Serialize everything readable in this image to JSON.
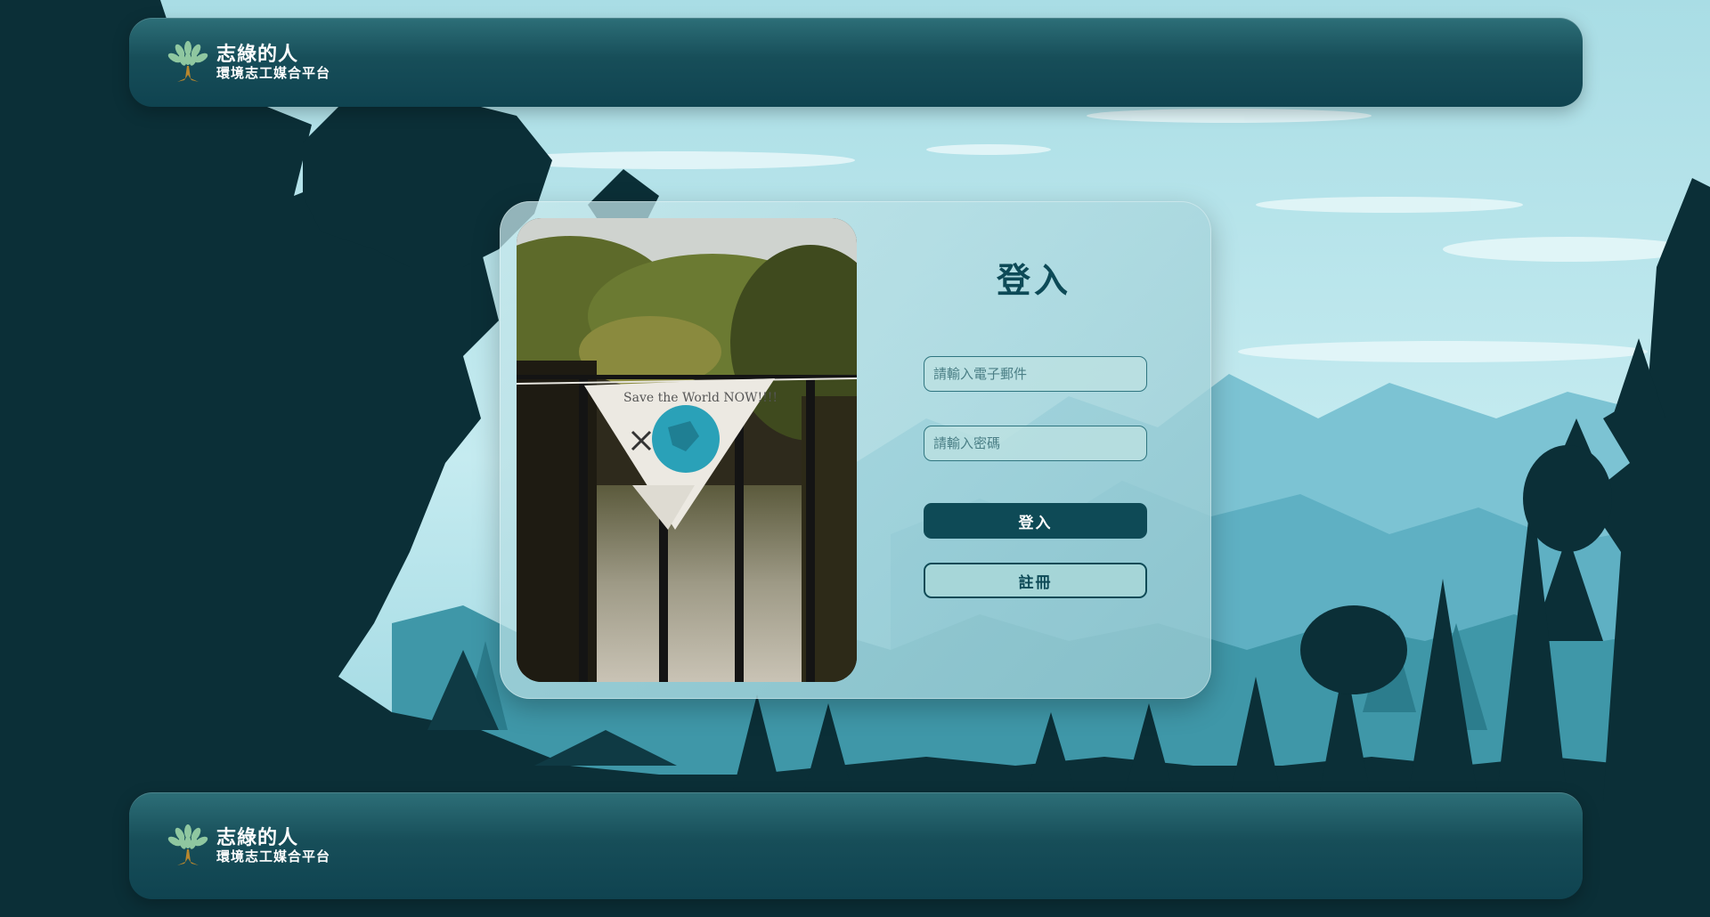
{
  "header": {
    "logo_icon": "tree-icon",
    "brand_title": "志綠的人",
    "brand_subtitle": "環境志工媒合平台"
  },
  "login": {
    "title": "登入",
    "email_placeholder": "請輸入電子郵件",
    "password_placeholder": "請輸入密碼",
    "login_button": "登入",
    "register_button": "註冊"
  },
  "photo": {
    "banner_text": "Save the World NOW!!!!"
  },
  "footer": {
    "logo_icon": "tree-icon",
    "brand_title": "志綠的人",
    "brand_subtitle": "環境志工媒合平台"
  },
  "colors": {
    "primary": "#0e4a56",
    "sky": "#bfe9ee",
    "forest": "#0b2f37",
    "accent_gold": "#b8872e"
  }
}
